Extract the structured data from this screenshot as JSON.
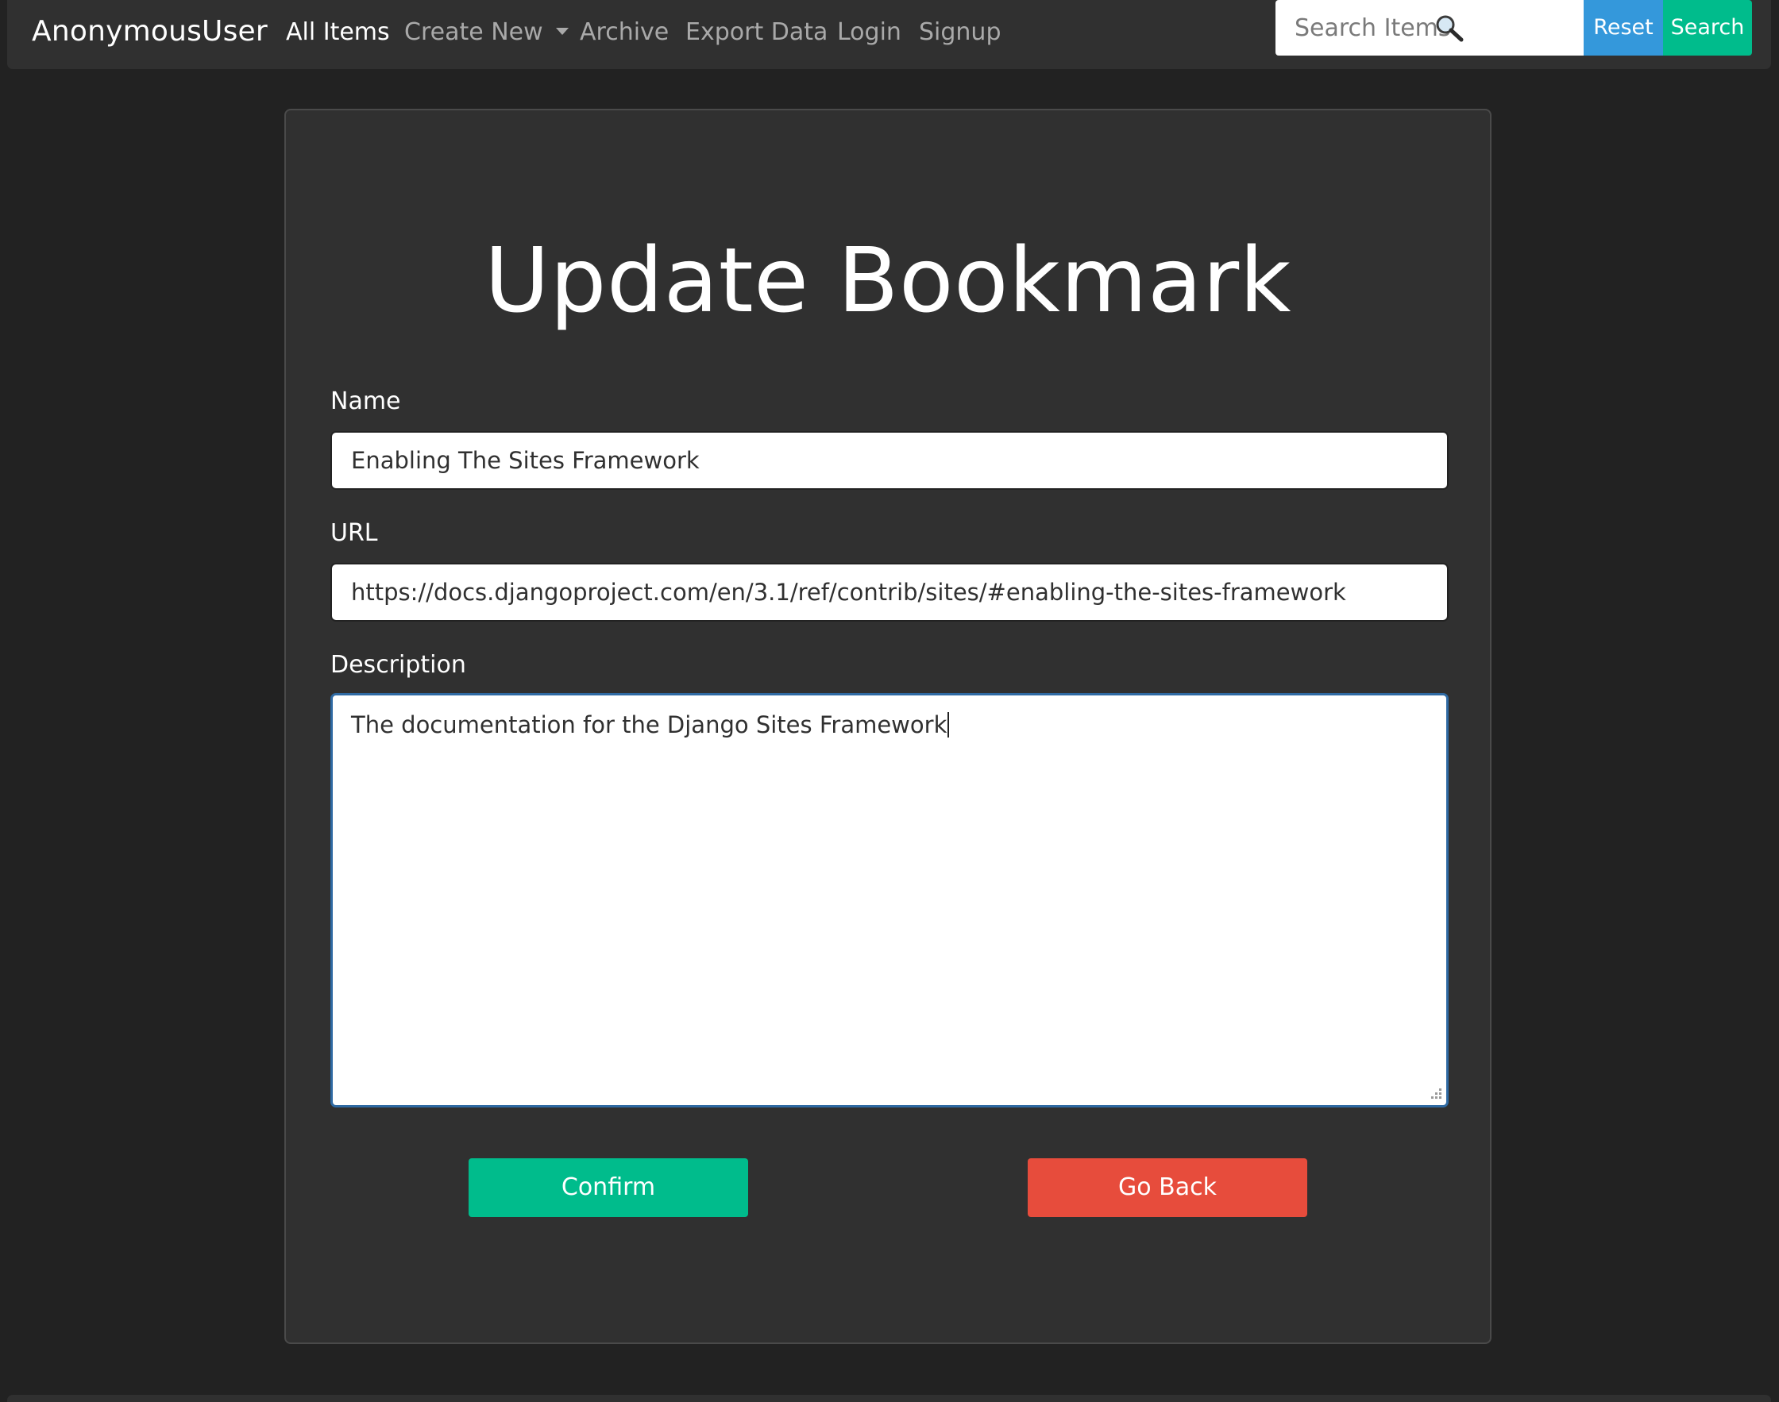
{
  "navbar": {
    "brand": "AnonymousUser",
    "items": [
      {
        "label": "All Items",
        "active": true
      },
      {
        "label": "Create New",
        "dropdown": true
      },
      {
        "label": "Archive"
      },
      {
        "label": "Export Data"
      },
      {
        "label": "Login"
      },
      {
        "label": "Signup"
      }
    ],
    "search": {
      "placeholder": "Search Items",
      "value": "",
      "icon": "magnifying-glass-icon"
    },
    "reset_label": "Reset",
    "search_label": "Search"
  },
  "form": {
    "title": "Update Bookmark",
    "name": {
      "label": "Name",
      "value": "Enabling The Sites Framework"
    },
    "url": {
      "label": "URL",
      "value": "https://docs.djangoproject.com/en/3.1/ref/contrib/sites/#enabling-the-sites-framework"
    },
    "description": {
      "label": "Description",
      "value": "The documentation for the Django Sites Framework"
    },
    "confirm_label": "Confirm",
    "back_label": "Go Back"
  },
  "colors": {
    "page_background": "#222222",
    "panel_background": "#303030",
    "success": "#00bc8c",
    "info": "#3498db",
    "danger": "#e74c3c",
    "focus_border": "#2f6aa3"
  }
}
